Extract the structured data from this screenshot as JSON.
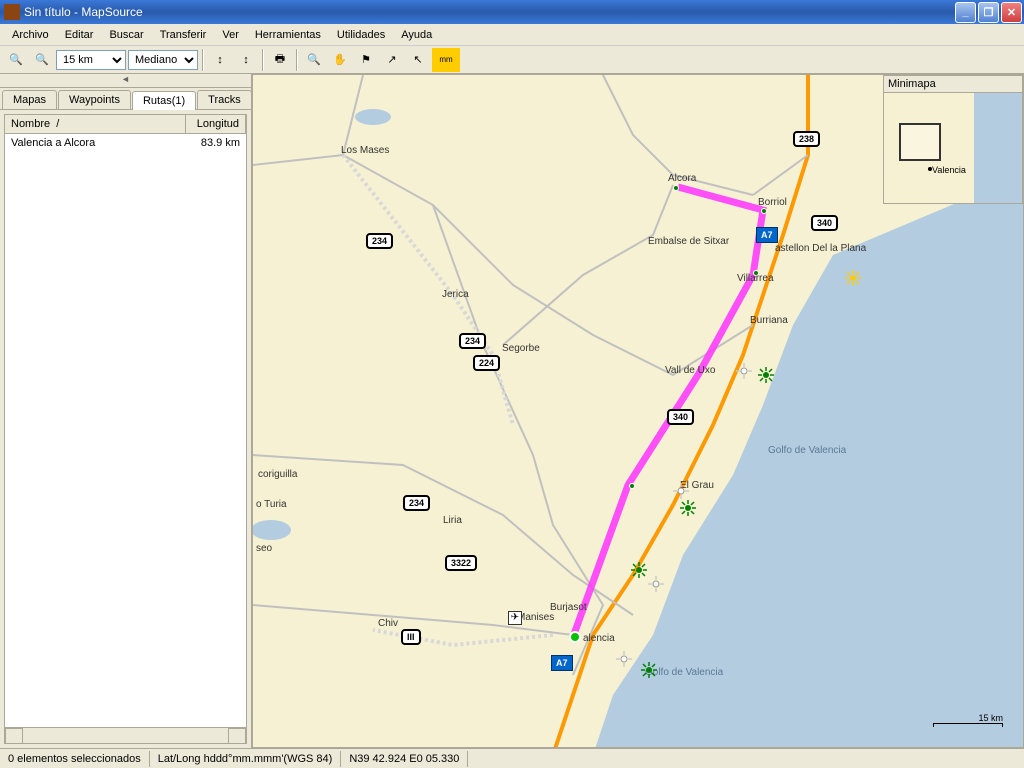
{
  "window": {
    "title": "Sin título - MapSource"
  },
  "menu": {
    "items": [
      "Archivo",
      "Editar",
      "Buscar",
      "Transferir",
      "Ver",
      "Herramientas",
      "Utilidades",
      "Ayuda"
    ]
  },
  "toolbar": {
    "zoom_select": "15 km",
    "detail_select": "Mediano"
  },
  "sidebar": {
    "tabs": [
      "Mapas",
      "Waypoints",
      "Rutas(1)",
      "Tracks"
    ],
    "active_tab": 2,
    "columns": {
      "name": "Nombre",
      "length": "Longitud"
    },
    "rows": [
      {
        "name": "Valencia a Alcora",
        "length": "83.9 km"
      }
    ]
  },
  "minimap": {
    "title": "Minimapa",
    "label": "Valencia"
  },
  "map": {
    "cities": {
      "los_mases": "Los Mases",
      "alcora": "Alcora",
      "borriol": "Borriol",
      "castellon": "astellon Del la Plana",
      "sitxar": "Embalse de Sitxar",
      "villarrea": "Villarrea",
      "burriana": "Burriana",
      "jerica": "Jerica",
      "segorbe": "Segorbe",
      "vall_de_uxo": "Vall de Uxo",
      "coriguilla": "coriguilla",
      "turia": "o Turia",
      "seo": "seo",
      "liria": "Liria",
      "chiv": "Chiv",
      "manises": "Manises",
      "burjasot": "Burjasot",
      "valencia": "alencia",
      "el_grau": "El Grau",
      "golfo1": "Golfo de Valencia",
      "golfo2": "Golfo de Valencia"
    },
    "shields": {
      "r234a": "234",
      "r234b": "234",
      "r234c": "234",
      "r224": "224",
      "r238": "238",
      "r340a": "340",
      "r340b": "340",
      "r3322": "3322",
      "rIII": "III",
      "a7a": "A7",
      "a7b": "A7"
    },
    "scale": "15 km"
  },
  "statusbar": {
    "selection": "0 elementos seleccionados",
    "format": "Lat/Long hddd°mm.mmm'(WGS 84)",
    "coords": "N39 42.924 E0 05.330"
  },
  "colors": {
    "land": "#f6f1d2",
    "sea": "#b4cce0",
    "route": "#ff00ff",
    "highway": "#ff9900"
  }
}
